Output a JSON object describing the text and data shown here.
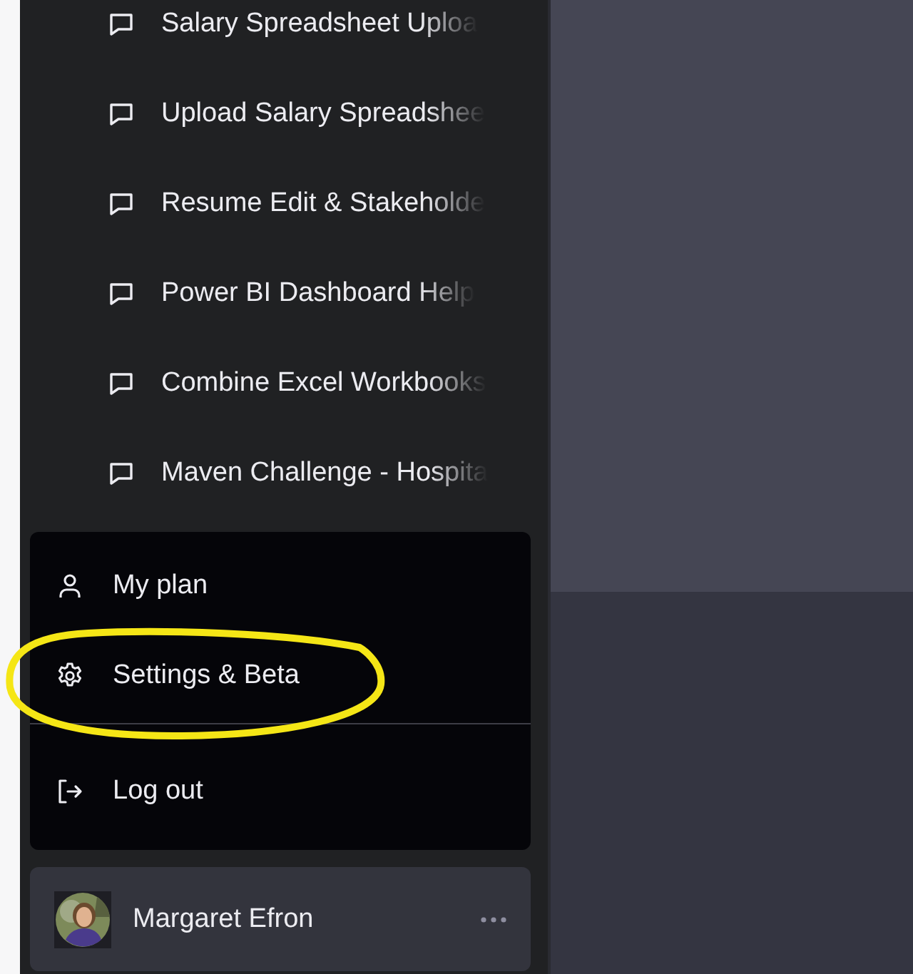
{
  "chats": [
    {
      "title": "Salary Spreadsheet Uploa"
    },
    {
      "title": "Upload Salary Spreadshee"
    },
    {
      "title": "Resume Edit & Stakeholde"
    },
    {
      "title": "Power BI Dashboard Help"
    },
    {
      "title": "Combine Excel Workbooks"
    },
    {
      "title": "Maven Challenge - Hospita"
    }
  ],
  "menu": [
    {
      "kind": "plan",
      "label": "My plan",
      "highlighted": false
    },
    {
      "kind": "settings",
      "label": "Settings & Beta",
      "highlighted": true
    },
    {
      "kind": "logout",
      "label": "Log out",
      "highlighted": false
    }
  ],
  "user": {
    "name": "Margaret Efron"
  }
}
